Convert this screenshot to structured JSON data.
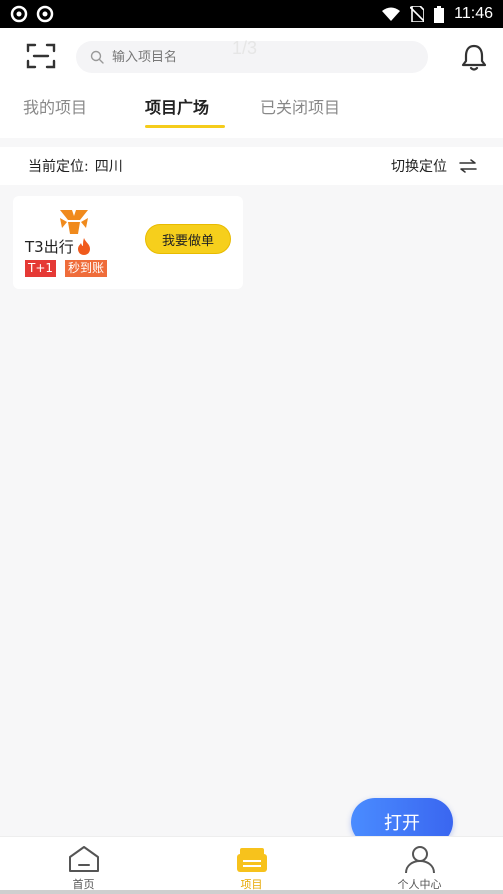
{
  "status_bar": {
    "time": "11:46"
  },
  "header": {
    "search_placeholder": "输入项目名",
    "page_indicator": "1/3"
  },
  "tabs": [
    {
      "label": "我的项目"
    },
    {
      "label": "项目广场"
    },
    {
      "label": "已关闭项目"
    }
  ],
  "location": {
    "label": "当前定位:",
    "value": "四川",
    "switch_label": "切换定位"
  },
  "project_card": {
    "name": "T3出行",
    "tag_1": "T+1",
    "tag_2": "秒到账",
    "button": "我要做单"
  },
  "open_button": "打开",
  "bottom_nav": {
    "home": "首页",
    "project": "项目",
    "profile": "个人中心"
  },
  "colors": {
    "accent": "#f5cc1b",
    "open_button": "#3a66f0",
    "tag_red": "#e53935",
    "tag_orange": "#ef6c3a",
    "brand_orange": "#f08a1c"
  },
  "icons": [
    "scan-icon",
    "search-icon",
    "bell-icon",
    "switch-arrows-icon",
    "t3-logo-icon",
    "fire-icon",
    "home-icon",
    "project-icon",
    "profile-icon"
  ]
}
